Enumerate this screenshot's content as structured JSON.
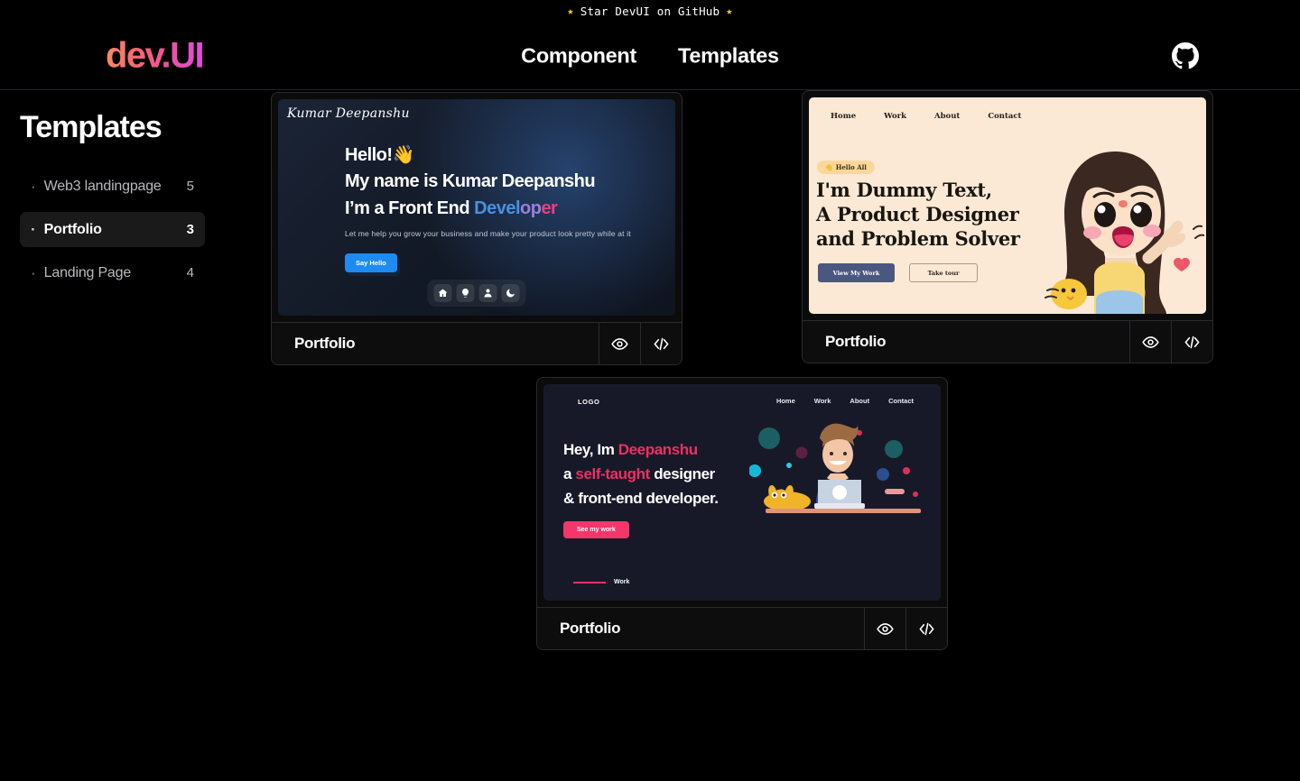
{
  "banner": {
    "text": "Star DevUI on GitHub",
    "star_icon": "star-icon"
  },
  "header": {
    "logo": "dev.UI",
    "nav": [
      {
        "label": "Component"
      },
      {
        "label": "Templates"
      }
    ],
    "github_icon": "github-icon"
  },
  "sidebar": {
    "title": "Templates",
    "items": [
      {
        "label": "Web3 landingpage",
        "count": "5",
        "active": false
      },
      {
        "label": "Portfolio",
        "count": "3",
        "active": true
      },
      {
        "label": "Landing Page",
        "count": "4",
        "active": false
      }
    ]
  },
  "cards": [
    {
      "title": "Portfolio",
      "preview_icon": "eye-icon",
      "code_icon": "code-icon",
      "preview": {
        "signature": "Kumar Deepanshu",
        "line1": "Hello!",
        "wave_emoji": "👋",
        "line2": "My name is Kumar Deepanshu",
        "line3_prefix": "I’m a Front End ",
        "line3_accent_a": "Devel",
        "line3_accent_b": "op",
        "line3_accent_c": "er",
        "subtitle": "Let me help you grow your business and make your product look pretty while at it",
        "button": "Say Hello",
        "dock": [
          {
            "icon": "home-icon"
          },
          {
            "icon": "lightbulb-icon"
          },
          {
            "icon": "person-icon"
          },
          {
            "icon": "moon-icon"
          }
        ]
      }
    },
    {
      "title": "Portfolio",
      "preview_icon": "eye-icon",
      "code_icon": "code-icon",
      "preview": {
        "nav": [
          "Home",
          "Work",
          "About",
          "Contact"
        ],
        "badge_emoji": "👋",
        "badge": "Hello All",
        "headline_1": "I'm Dummy Text,",
        "headline_2": "A Product Designer",
        "headline_3": "and Problem Solver",
        "primary_button": "View My Work",
        "ghost_button": "Take tour",
        "art": "girl-waving-illustration"
      }
    },
    {
      "title": "Portfolio",
      "preview_icon": "eye-icon",
      "code_icon": "code-icon",
      "preview": {
        "logo": "LOGO",
        "nav": [
          "Home",
          "Work",
          "About",
          "Contact"
        ],
        "line1_prefix": "Hey, Im ",
        "line1_accent": "Deepanshu",
        "line2_prefix": "a ",
        "line2_accent": "self-taught",
        "line2_suffix": " designer",
        "line3": "& front-end developer.",
        "button": "See my work",
        "work_label": "Work",
        "art": "developer-at-desk-illustration"
      }
    }
  ],
  "colors": {
    "page_bg": "#000000",
    "logo_gradient_start": "#fb8a6a",
    "logo_gradient_end": "#e24ae0",
    "active_item_bg": "#1a1a1a",
    "card_border": "#2b2b2f",
    "card2_bg": "#fbe9d5",
    "card3_bg": "#181928",
    "card3_accent": "#ed2f63",
    "card1_accent": "#1d8bf1",
    "star_yellow": "#f5d020"
  }
}
